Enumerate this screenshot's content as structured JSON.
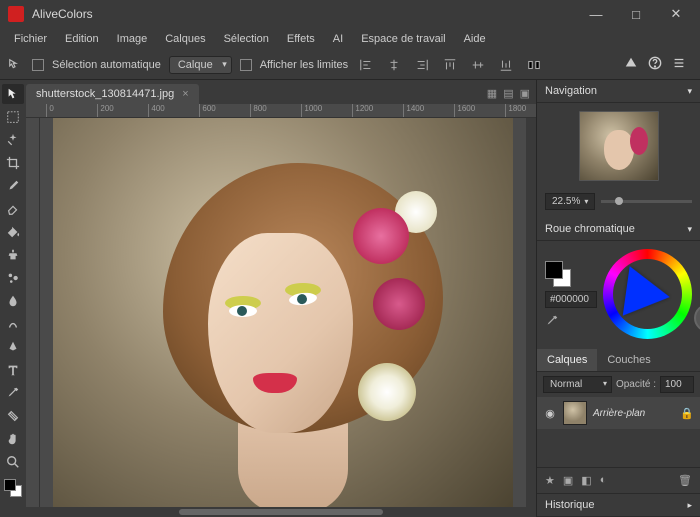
{
  "app": {
    "title": "AliveColors"
  },
  "menu": [
    "Fichier",
    "Edition",
    "Image",
    "Calques",
    "Sélection",
    "Effets",
    "AI",
    "Espace de travail",
    "Aide"
  ],
  "options": {
    "auto_select": "Sélection automatique",
    "layer_dropdown": "Calque",
    "show_bounds": "Afficher les limites"
  },
  "document": {
    "tab_name": "shutterstock_130814471.jpg",
    "ruler_ticks": [
      "0",
      "200",
      "400",
      "600",
      "800",
      "1000",
      "1200",
      "1400",
      "1600",
      "1800"
    ]
  },
  "navigation": {
    "title": "Navigation",
    "zoom": "22.5%"
  },
  "color": {
    "title": "Roue chromatique",
    "hex": "#000000"
  },
  "layers": {
    "tab1": "Calques",
    "tab2": "Couches",
    "blend_mode": "Normal",
    "opacity_label": "Opacité :",
    "opacity_value": "100",
    "layer_name": "Arrière-plan"
  },
  "history": {
    "title": "Historique"
  }
}
